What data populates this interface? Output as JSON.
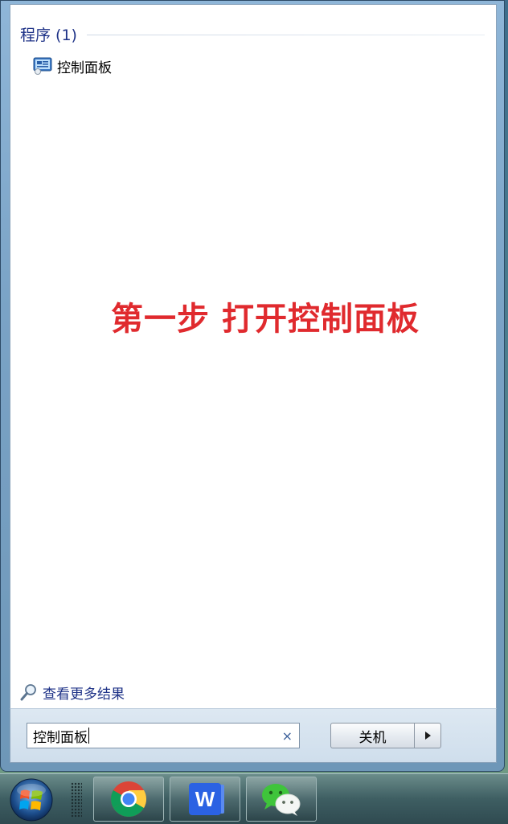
{
  "results": {
    "group_title": "程序 (1)",
    "programs": [
      {
        "label": "控制面板",
        "icon": "control-panel-icon"
      }
    ],
    "see_more_label": "查看更多结果"
  },
  "overlay": {
    "caption": "第一步 打开控制面板",
    "color": "#e02a2e"
  },
  "search": {
    "value": "控制面板",
    "clear_glyph": "×"
  },
  "power": {
    "shutdown_label": "关机"
  },
  "taskbar": {
    "apps": [
      {
        "name": "Chrome",
        "icon": "chrome-icon"
      },
      {
        "name": "Word",
        "icon": "word-icon",
        "glyph": "W"
      },
      {
        "name": "WeChat",
        "icon": "wechat-icon"
      }
    ]
  },
  "colors": {
    "link": "#1e3287",
    "accent_blue": "#2b62e3",
    "wechat_green": "#3fc43b"
  }
}
